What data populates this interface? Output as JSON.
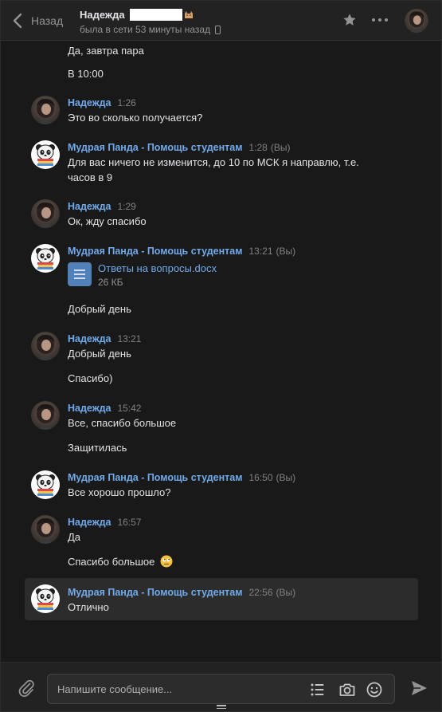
{
  "header": {
    "back_label": "Назад",
    "peer_name": "Надежда",
    "peer_status": "была в сети 53 минуты назад"
  },
  "messages": {
    "top_text_1": "Да, завтра пара",
    "top_text_2": "В 10:00",
    "g1": {
      "author": "Надежда",
      "time": "1:26",
      "text": "Это во сколько получается?"
    },
    "g2": {
      "author": "Мудрая Панда - Помощь студентам",
      "time": "1:28",
      "you": "(Вы)",
      "text_line1": "Для вас ничего не изменится, до 10 по МСК я направлю, т.е.",
      "text_line2": "часов в 9"
    },
    "g3": {
      "author": "Надежда",
      "time": "1:29",
      "text": "Ок, жду спасибо"
    },
    "g4": {
      "author": "Мудрая Панда - Помощь студентам",
      "time": "13:21",
      "you": "(Вы)",
      "file_name": "Ответы на вопросы.docx",
      "file_size": "26 КБ",
      "text": "Добрый день"
    },
    "g5": {
      "author": "Надежда",
      "time": "13:21",
      "text_1": "Добрый день",
      "text_2": "Спасибо)"
    },
    "g6": {
      "author": "Надежда",
      "time": "15:42",
      "text_1": "Все, спасибо большое",
      "text_2": "Защитилась"
    },
    "g7": {
      "author": "Мудрая Панда - Помощь студентам",
      "time": "16:50",
      "you": "(Вы)",
      "text": "Все хорошо прошло?"
    },
    "g8": {
      "author": "Надежда",
      "time": "16:57",
      "text_1": "Да",
      "text_2": "Спасибо большое"
    },
    "g9": {
      "author": "Мудрая Панда - Помощь студентам",
      "time": "22:56",
      "you": "(Вы)",
      "text": "Отлично"
    }
  },
  "composer": {
    "placeholder": "Напишите сообщение..."
  },
  "icons": {
    "back": "chevron-left-icon",
    "favorite": "star-icon",
    "more": "more-dots-icon",
    "attach": "paperclip-icon",
    "templates": "list-icon",
    "photo": "camera-icon",
    "emoji": "smile-icon",
    "send": "send-icon"
  },
  "colors": {
    "background": "#191919",
    "header": "#222222",
    "author_link": "#71aaeb",
    "selected_row": "#2c2c2c",
    "file_icon": "#5181b8"
  }
}
